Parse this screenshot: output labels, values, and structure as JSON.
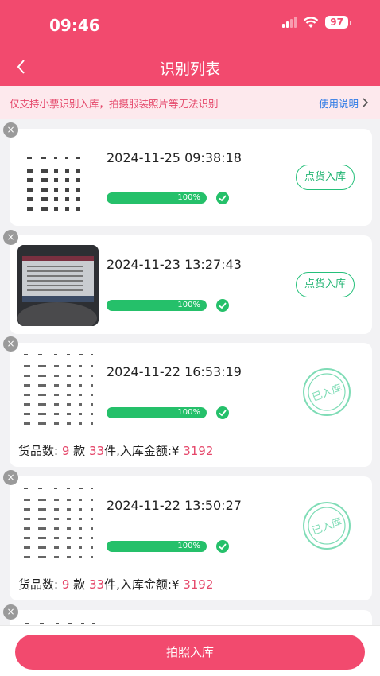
{
  "status_bar": {
    "time": "09:46",
    "battery": "97"
  },
  "header": {
    "title": "识别列表"
  },
  "notice": {
    "text": "仅支持小票识别入库，拍摄服装照片等无法识别",
    "link": "使用说明"
  },
  "records": [
    {
      "time": "2024-11-25 09:38:18",
      "progress": "100%",
      "progress_value": 1.0,
      "action": "点货入库"
    },
    {
      "time": "2024-11-23 13:27:43",
      "progress": "100%",
      "progress_value": 1.0,
      "action": "点货入库"
    },
    {
      "time": "2024-11-22 16:53:19",
      "progress": "100%",
      "progress_value": 1.0,
      "stamp": "已入库",
      "summary": {
        "prefix": "货品数:",
        "kinds": "9",
        "kinds_unit": "款",
        "pieces": "33",
        "pieces_unit": "件,入库金额:",
        "currency": "¥",
        "amount": "3192"
      }
    },
    {
      "time": "2024-11-22 13:50:27",
      "progress": "100%",
      "progress_value": 1.0,
      "stamp": "已入库",
      "summary": {
        "prefix": "货品数:",
        "kinds": "9",
        "kinds_unit": "款",
        "pieces": "33",
        "pieces_unit": "件,入库金额:",
        "currency": "¥",
        "amount": "3192"
      }
    }
  ],
  "footer": {
    "button": "拍照入库"
  },
  "colors": {
    "brand": "#f24a6e",
    "success": "#25c06a",
    "link": "#2f7be6"
  }
}
